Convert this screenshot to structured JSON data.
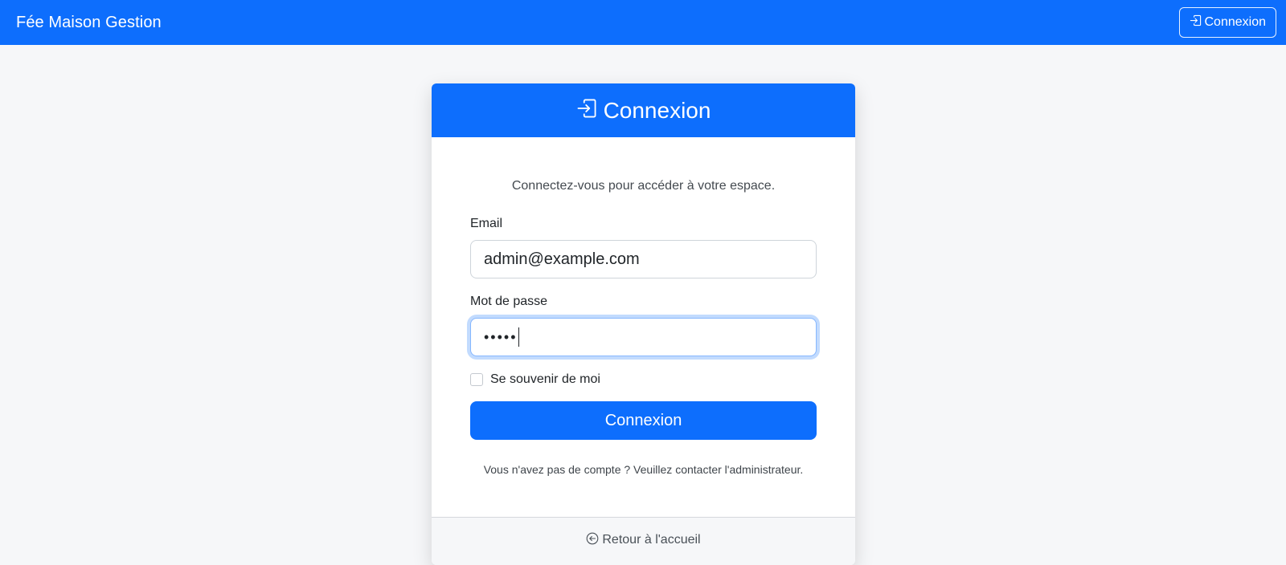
{
  "navbar": {
    "brand": "Fée Maison Gestion",
    "login_button": "Connexion"
  },
  "card": {
    "title": "Connexion",
    "subtitle": "Connectez-vous pour accéder à votre espace.",
    "email_label": "Email",
    "email_value": "admin@example.com",
    "password_label": "Mot de passe",
    "password_value": "•••••",
    "remember_label": "Se souvenir de moi",
    "remember_checked": false,
    "submit_label": "Connexion",
    "footnote": "Vous n'avez pas de compte ? Veuillez contacter l'administrateur.",
    "back_link": "Retour à l'accueil"
  },
  "icons": {
    "login": "box-arrow-in-right-icon",
    "back": "arrow-left-circle-icon"
  },
  "colors": {
    "primary": "#0d6efd",
    "background": "#f6f7f9"
  }
}
